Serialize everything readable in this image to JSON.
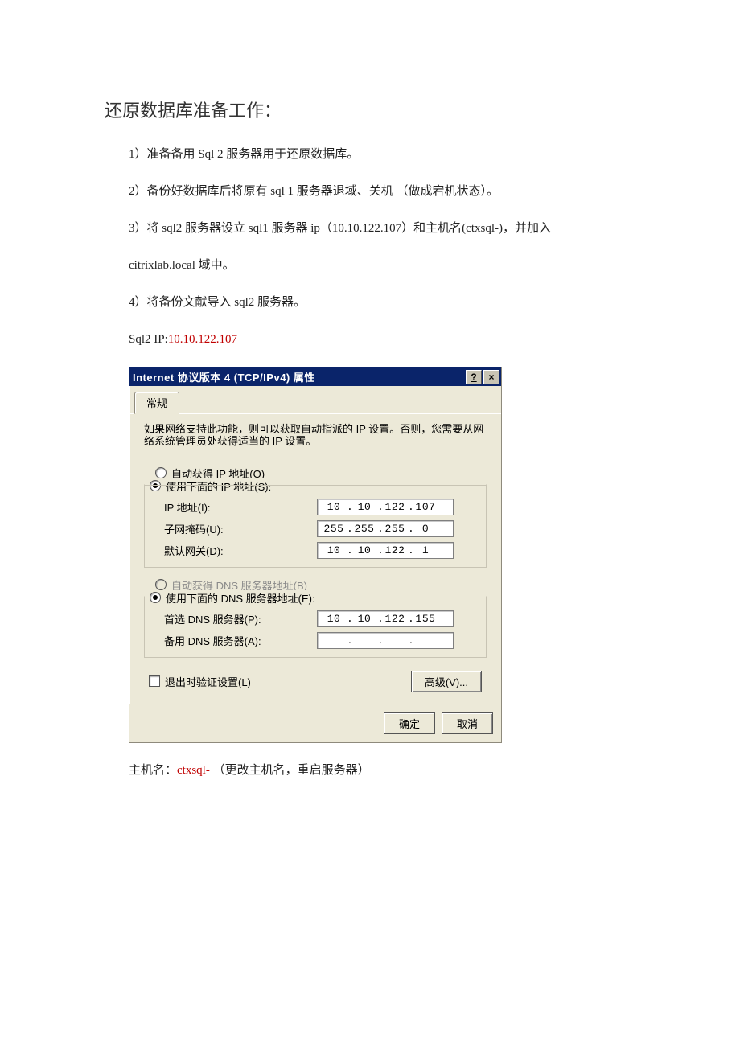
{
  "doc": {
    "title": "还原数据库准备工作：",
    "lines": [
      "1）准备备用 Sql 2  服务器用于还原数据库。",
      "2）备份好数据库后将原有 sql 1  服务器退域、关机 （做成宕机状态）。",
      "3）将 sql2  服务器设立 sql1 服务器  ip（10.10.122.107）和主机名(ctxsql-)，并加入",
      "citrixlab.local 域中。",
      "4）将备份文献导入 sql2 服务器。"
    ],
    "ip_label": "Sql2 IP:",
    "ip_value": "10.10.122.107",
    "hostname_label": "主机名：",
    "hostname_value": "ctxsql- ",
    "hostname_tail": "（更改主机名，重启服务器）"
  },
  "dialog": {
    "title": "Internet 协议版本 4 (TCP/IPv4) 属性",
    "help_btn": "?",
    "close_btn": "×",
    "tab_general": "常规",
    "info": "如果网络支持此功能，则可以获取自动指派的 IP 设置。否则，您需要从网络系统管理员处获得适当的 IP 设置。",
    "ip_auto": "自动获得 IP 地址(O)",
    "ip_manual": "使用下面的 IP 地址(S):",
    "ip_addr_lbl": "IP 地址(I):",
    "ip_addr": [
      "10",
      "10",
      "122",
      "107"
    ],
    "mask_lbl": "子网掩码(U):",
    "mask": [
      "255",
      "255",
      "255",
      "0"
    ],
    "gw_lbl": "默认网关(D):",
    "gw": [
      "10",
      "10",
      "122",
      "1"
    ],
    "dns_auto": "自动获得 DNS 服务器地址(B)",
    "dns_manual": "使用下面的 DNS 服务器地址(E):",
    "dns1_lbl": "首选 DNS 服务器(P):",
    "dns1": [
      "10",
      "10",
      "122",
      "155"
    ],
    "dns2_lbl": "备用 DNS 服务器(A):",
    "dns2": [
      "",
      "",
      "",
      ""
    ],
    "exit_check": "退出时验证设置(L)",
    "advanced_btn": "高级(V)...",
    "ok_btn": "确定",
    "cancel_btn": "取消"
  }
}
